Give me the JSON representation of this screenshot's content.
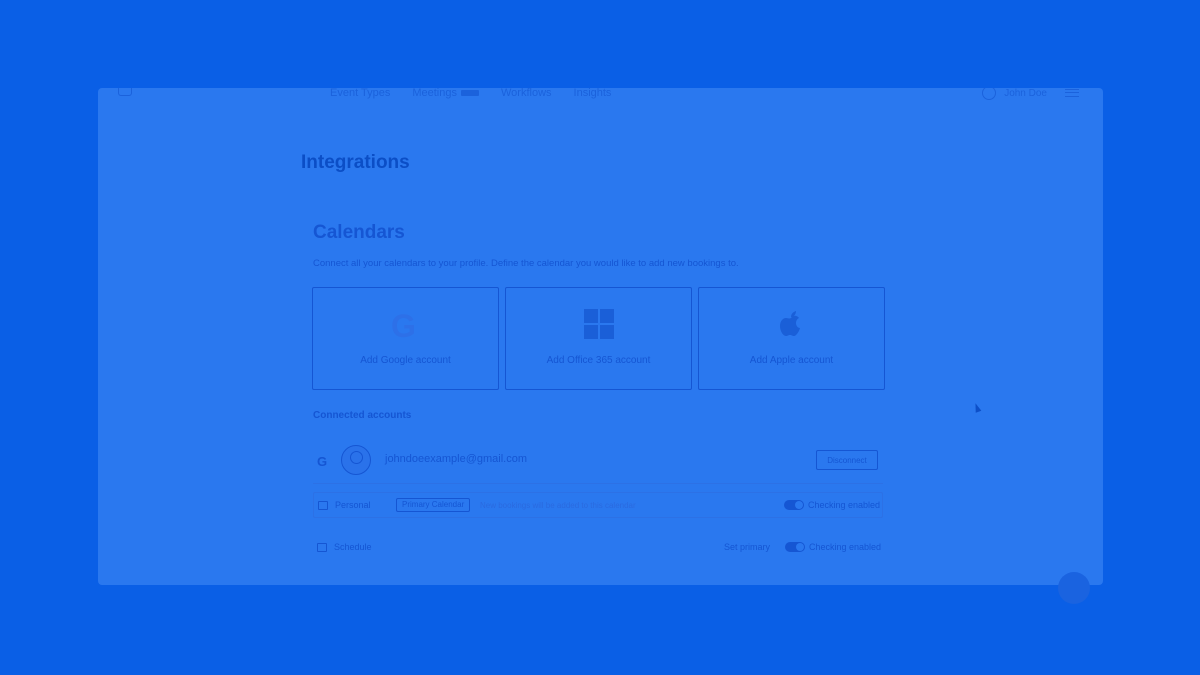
{
  "nav": {
    "items": [
      "Event Types",
      "Meetings",
      "Workflows",
      "Insights"
    ],
    "user_name": "John Doe"
  },
  "page": {
    "title": "Integrations"
  },
  "calendars": {
    "title": "Calendars",
    "description": "Connect all your calendars to your profile. Define the calendar you would like to add new bookings to.",
    "providers": [
      {
        "label": "Add Google account",
        "icon": "google-icon"
      },
      {
        "label": "Add Office 365 account",
        "icon": "office-icon"
      },
      {
        "label": "Add Apple account",
        "icon": "apple-icon"
      }
    ],
    "connected_title": "Connected accounts",
    "account": {
      "email": "johndoeexample@gmail.com",
      "disconnect_label": "Disconnect"
    },
    "rows": [
      {
        "name": "Personal",
        "badge": "Primary Calendar",
        "note": "New bookings will be added to this calendar",
        "toggle_label": "Checking enabled"
      },
      {
        "name": "Schedule",
        "set_primary_label": "Set primary",
        "toggle_label": "Checking enabled"
      }
    ]
  },
  "colors": {
    "background": "#0a5fe6",
    "panel": "#2a78ef",
    "accent": "#1556d3"
  }
}
